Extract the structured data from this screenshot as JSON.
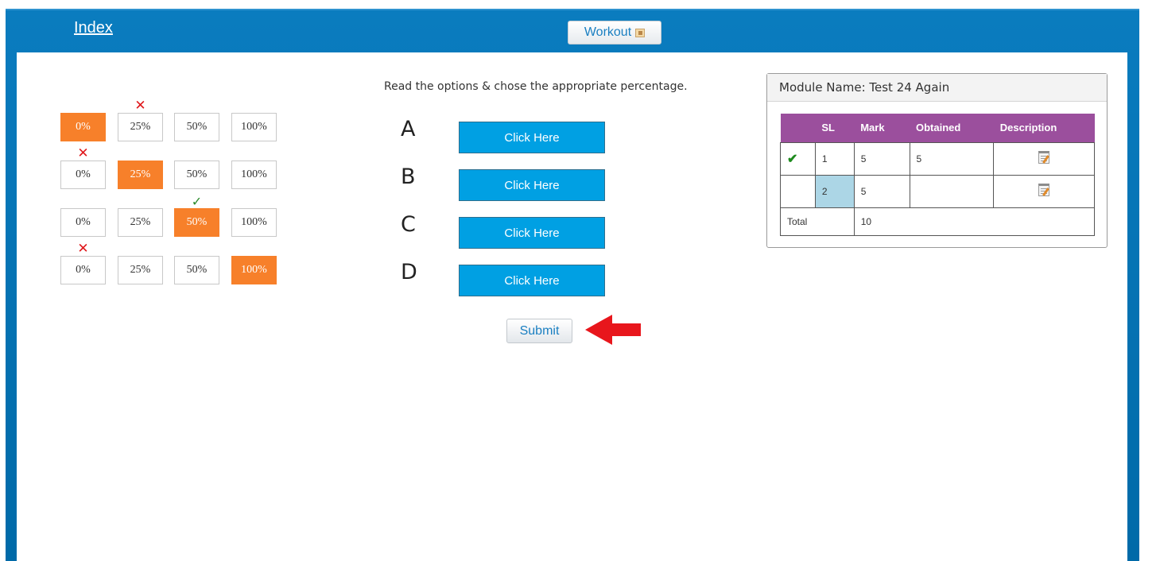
{
  "header": {
    "index_link": "Index",
    "workout_button": "Workout",
    "workout_icon": "edit-icon"
  },
  "instruction": "Read the options & chose the appropriate percentage.",
  "percentage_grid": {
    "rows": [
      {
        "options": [
          "0%",
          "25%",
          "50%",
          "100%"
        ],
        "selected": "0%",
        "mark": "x",
        "mark_over": "25%"
      },
      {
        "options": [
          "0%",
          "25%",
          "50%",
          "100%"
        ],
        "selected": "25%",
        "mark": "x",
        "mark_over": "0%"
      },
      {
        "options": [
          "0%",
          "25%",
          "50%",
          "100%"
        ],
        "selected": "50%",
        "mark": "check",
        "mark_over": "50%"
      },
      {
        "options": [
          "0%",
          "25%",
          "50%",
          "100%"
        ],
        "selected": "100%",
        "mark": "x",
        "mark_over": "0%"
      }
    ],
    "selected_color": "#f7802a",
    "wrong_mark": "✕",
    "right_mark": "✓"
  },
  "options": [
    {
      "letter": "A",
      "button": "Click Here"
    },
    {
      "letter": "B",
      "button": "Click Here"
    },
    {
      "letter": "C",
      "button": "Click Here"
    },
    {
      "letter": "D",
      "button": "Click Here"
    }
  ],
  "submit_label": "Submit",
  "module": {
    "title": "Module Name: Test 24 Again",
    "columns": [
      "",
      "SL",
      "Mark",
      "Obtained",
      "Description"
    ],
    "rows": [
      {
        "status": "✔",
        "sl": "1",
        "mark": "5",
        "obtained": "5"
      },
      {
        "status": "",
        "sl": "2",
        "mark": "5",
        "obtained": ""
      }
    ],
    "total_label": "Total",
    "total_value": "10"
  },
  "colors": {
    "frame": "#0a7cbf",
    "click_button": "#00a0e3",
    "table_header": "#9b4f9d",
    "highlight_cell": "#acd6e6",
    "arrow": "#e8161c"
  }
}
